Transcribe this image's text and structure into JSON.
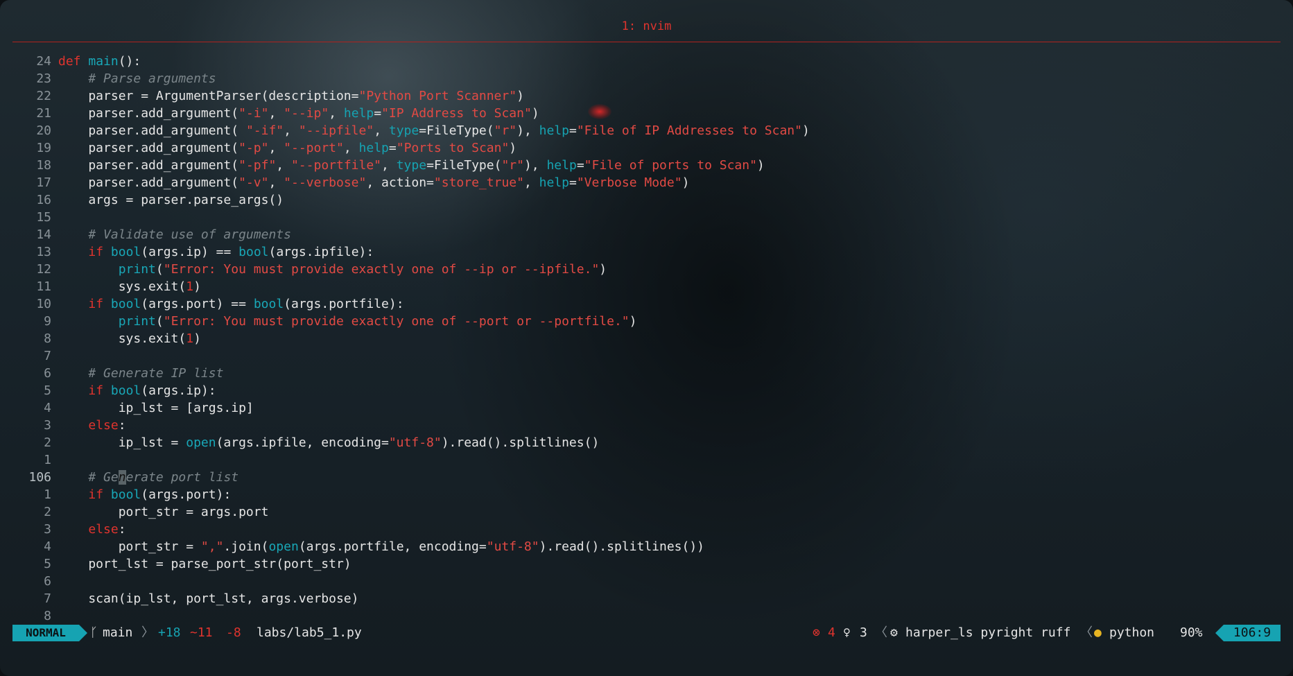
{
  "window": {
    "tab_title": "1: nvim"
  },
  "editor": {
    "lines": [
      {
        "num": "24",
        "html": "<span class='kw'>def</span> <span class='fn'>main</span>():"
      },
      {
        "num": "23",
        "html": "    <span class='com'># Parse arguments</span>"
      },
      {
        "num": "22",
        "html": "    parser = ArgumentParser(description=<span class='str'>\"Python Port Scanner\"</span>)"
      },
      {
        "num": "21",
        "html": "    parser.add_argument(<span class='str'>\"-i\"</span>, <span class='str'>\"--ip\"</span>, <span class='par'>help</span>=<span class='str'>\"IP Address to Scan\"</span>)"
      },
      {
        "num": "20",
        "html": "    parser.add_argument( <span class='str'>\"-if\"</span>, <span class='str'>\"--ipfile\"</span>, <span class='par'>type</span>=FileType(<span class='str'>\"r\"</span>), <span class='par'>help</span>=<span class='str'>\"File of IP Addresses to Scan\"</span>)"
      },
      {
        "num": "19",
        "html": "    parser.add_argument(<span class='str'>\"-p\"</span>, <span class='str'>\"--port\"</span>, <span class='par'>help</span>=<span class='str'>\"Ports to Scan\"</span>)"
      },
      {
        "num": "18",
        "html": "    parser.add_argument(<span class='str'>\"-pf\"</span>, <span class='str'>\"--portfile\"</span>, <span class='par'>type</span>=FileType(<span class='str'>\"r\"</span>), <span class='par'>help</span>=<span class='str'>\"File of ports to Scan\"</span>)"
      },
      {
        "num": "17",
        "html": "    parser.add_argument(<span class='str'>\"-v\"</span>, <span class='str'>\"--verbose\"</span>, action=<span class='str'>\"store_true\"</span>, <span class='par'>help</span>=<span class='str'>\"Verbose Mode\"</span>)"
      },
      {
        "num": "16",
        "html": "    args = parser.parse_args()"
      },
      {
        "num": "15",
        "html": ""
      },
      {
        "num": "14",
        "html": "    <span class='com'># Validate use of arguments</span>"
      },
      {
        "num": "13",
        "html": "    <span class='kw'>if</span> <span class='fn'>bool</span>(args.ip) == <span class='fn'>bool</span>(args.ipfile):"
      },
      {
        "num": "12",
        "html": "        <span class='fn'>print</span>(<span class='str'>\"Error: You must provide exactly one of --ip or --ipfile.\"</span>)"
      },
      {
        "num": "11",
        "html": "        sys.exit(<span class='num'>1</span>)"
      },
      {
        "num": "10",
        "html": "    <span class='kw'>if</span> <span class='fn'>bool</span>(args.port) == <span class='fn'>bool</span>(args.portfile):"
      },
      {
        "num": "9",
        "html": "        <span class='fn'>print</span>(<span class='str'>\"Error: You must provide exactly one of --port or --portfile.\"</span>)"
      },
      {
        "num": "8",
        "html": "        sys.exit(<span class='num'>1</span>)"
      },
      {
        "num": "7",
        "html": ""
      },
      {
        "num": "6",
        "html": "    <span class='com'># Generate IP list</span>"
      },
      {
        "num": "5",
        "html": "    <span class='kw'>if</span> <span class='fn'>bool</span>(args.ip):"
      },
      {
        "num": "4",
        "html": "        ip_lst = [args.ip]"
      },
      {
        "num": "3",
        "html": "    <span class='kw'>else</span>:"
      },
      {
        "num": "2",
        "html": "        ip_lst = <span class='fn'>open</span>(args.ipfile, encoding=<span class='str'>\"utf-8\"</span>).read().splitlines()"
      },
      {
        "num": "1",
        "html": ""
      },
      {
        "num": "106",
        "current": true,
        "html": "    <span class='com'># Ge<span class='cursor'>n</span>erate port list</span>"
      },
      {
        "num": "1",
        "html": "    <span class='kw'>if</span> <span class='fn'>bool</span>(args.port):"
      },
      {
        "num": "2",
        "html": "        port_str = args.port"
      },
      {
        "num": "3",
        "html": "    <span class='kw'>else</span>:"
      },
      {
        "num": "4",
        "html": "        port_str = <span class='str'>\",\"</span>.join(<span class='fn'>open</span>(args.portfile, encoding=<span class='str'>\"utf-8\"</span>).read().splitlines())"
      },
      {
        "num": "5",
        "html": "    port_lst = parse_port_str(port_str)"
      },
      {
        "num": "6",
        "html": ""
      },
      {
        "num": "7",
        "html": "    scan(ip_lst, port_lst, args.verbose)"
      },
      {
        "num": "8",
        "html": ""
      }
    ]
  },
  "statusline": {
    "mode": "NORMAL",
    "branch_icon": "git-branch-icon",
    "branch": "main",
    "diff_added": "+18",
    "diff_changed": "~11",
    "diff_removed": "-8",
    "file": "labs/lab5_1.py",
    "errors": "4",
    "hints": "3",
    "lsp_clients": "harper_ls pyright ruff",
    "filetype": "python",
    "progress": "90%",
    "position": "106:9",
    "colors": {
      "accent": "#16a3b2",
      "error": "#e0342e"
    }
  }
}
